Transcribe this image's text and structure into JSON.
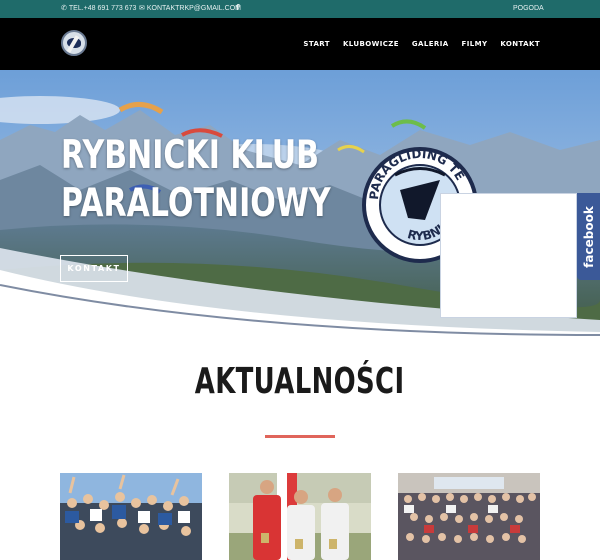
{
  "topbar": {
    "phone_icon": "phone-icon",
    "phone": "TEL.+48 691 773 673",
    "email_icon": "envelope-icon",
    "email": "KONTAKTRKP@GMAIL.COM",
    "facebook_icon": "facebook-icon",
    "facebook_glyph": "f",
    "weather_link": "POGODA"
  },
  "header": {
    "logo": "club-logo",
    "nav": [
      "START",
      "KLUBOWICZE",
      "GALERIA",
      "FILMY",
      "KONTAKT"
    ]
  },
  "hero": {
    "title_line1": "RYBNICKI KLUB",
    "title_line2": "PARALOTNIOWY",
    "button_label": "KONTAKT",
    "badge_text_top": "PARAGLIDING TE",
    "badge_text_bottom": "RYBNI",
    "facebook_tab": "facebook"
  },
  "news": {
    "title": "AKTUALNOŚCI",
    "cards": [
      {
        "image": "group-photo-celebration"
      },
      {
        "image": "two-pilots-with-flag"
      },
      {
        "image": "large-group-indoor-photo"
      }
    ]
  },
  "colors": {
    "topbar": "#1f6b6a",
    "header": "#000000",
    "accent_red": "#e0655b",
    "facebook_blue": "#3b5998"
  }
}
